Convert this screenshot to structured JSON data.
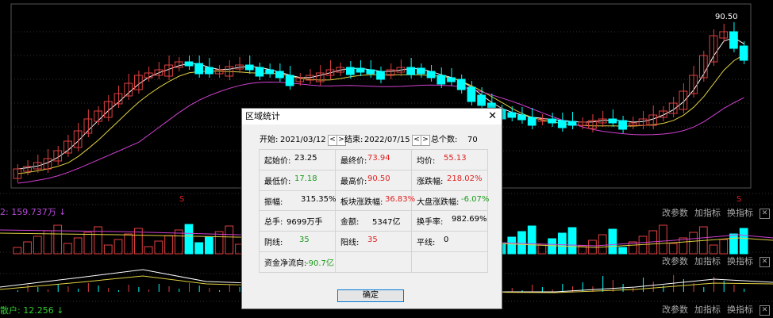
{
  "chart": {
    "max_label": "90.50",
    "marker_glyph": "S",
    "colors": {
      "up": "#e04040",
      "down": "#00ffff",
      "ma5": "#ffffff",
      "ma10": "#e0d040",
      "ma20": "#d040d0",
      "bg": "#000000"
    }
  },
  "volume_header": {
    "left": "2: 159.737万 ↓"
  },
  "panel_buttons": {
    "params": "改参数",
    "add": "加指标",
    "swap": "换指标",
    "close": "✕"
  },
  "bottom_header": {
    "left": "散户: 12.256 ↓"
  },
  "dialog": {
    "title": "区域统计",
    "close": "✕",
    "start_label": "开始:",
    "start_date": "2021/03/12",
    "prev": "<",
    "next": ">",
    "end_label": "结束:",
    "end_date": "2022/07/15",
    "total_label": "总个数:",
    "total_value": "70",
    "ok": "确定",
    "rows": [
      [
        {
          "label": "起始价:",
          "value": "23.25",
          "color": "blk"
        },
        {
          "label": "最终价:",
          "value": "73.94",
          "color": "red"
        },
        {
          "label": "均价:",
          "value": "55.13",
          "color": "red"
        }
      ],
      [
        {
          "label": "最低价:",
          "value": "17.18",
          "color": "green"
        },
        {
          "label": "最高价:",
          "value": "90.50",
          "color": "red"
        },
        {
          "label": "涨跌幅:",
          "value": "218.02%",
          "color": "red"
        }
      ],
      [
        {
          "label": "振幅:",
          "value": "315.35%",
          "color": "blk"
        },
        {
          "label": "板块涨跌幅:",
          "value": "36.83%",
          "color": "red"
        },
        {
          "label": "大盘涨跌幅:",
          "value": "-6.07%",
          "color": "green"
        }
      ],
      [
        {
          "label": "总手:",
          "value": "9699万手",
          "color": "blk"
        },
        {
          "label": "金额:",
          "value": "5347亿",
          "color": "blk"
        },
        {
          "label": "换手率:",
          "value": "982.69%",
          "color": "blk"
        }
      ],
      [
        {
          "label": "阴线:",
          "value": "35",
          "color": "green"
        },
        {
          "label": "阳线:",
          "value": "35",
          "color": "red"
        },
        {
          "label": "平线:",
          "value": "0",
          "color": "blk"
        }
      ],
      [
        {
          "label": "资金净流向:",
          "value": "-90.7亿",
          "color": "green"
        },
        {
          "label": "",
          "value": "",
          "color": "blk"
        },
        {
          "label": "",
          "value": "",
          "color": "blk"
        }
      ]
    ]
  }
}
